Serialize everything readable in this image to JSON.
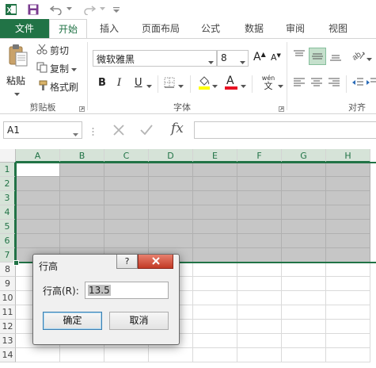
{
  "qat": {
    "excel_icon": "excel-logo-icon",
    "save_icon": "save-icon",
    "undo_icon": "undo-icon",
    "redo_icon": "redo-icon",
    "customize_icon": "customize-qat-icon"
  },
  "tabs": [
    "文件",
    "开始",
    "插入",
    "页面布局",
    "公式",
    "数据",
    "审阅",
    "视图"
  ],
  "clipboard": {
    "paste": "粘贴",
    "cut": "剪切",
    "copy": "复制",
    "format_painter": "格式刷",
    "group_label": "剪贴板"
  },
  "font": {
    "name": "微软雅黑",
    "size": "8",
    "grow": "A",
    "shrink": "A",
    "bold": "B",
    "italic": "I",
    "underline": "U",
    "phonetic_top": "wén",
    "phonetic_bottom": "文",
    "font_color_letter": "A",
    "group_label": "字体",
    "fill_color": "#ffff00",
    "font_color": "#e81123"
  },
  "alignment": {
    "group_label": "对齐"
  },
  "formula_bar": {
    "name_box": "A1",
    "fx": "fx",
    "value": ""
  },
  "grid": {
    "columns": [
      "A",
      "B",
      "C",
      "D",
      "E",
      "F",
      "G",
      "H"
    ],
    "rows": [
      "1",
      "2",
      "3",
      "4",
      "5",
      "6",
      "7",
      "8",
      "9",
      "10",
      "11",
      "12",
      "13",
      "14"
    ],
    "selected_rows": [
      "1",
      "2",
      "3",
      "4",
      "5",
      "6",
      "7"
    ],
    "selection_fill": "#c6c6c6",
    "accent": "#217346"
  },
  "dialog": {
    "title": "行高",
    "help": "?",
    "label": "行高(R):",
    "value": "13.5",
    "ok": "确定",
    "cancel": "取消"
  }
}
